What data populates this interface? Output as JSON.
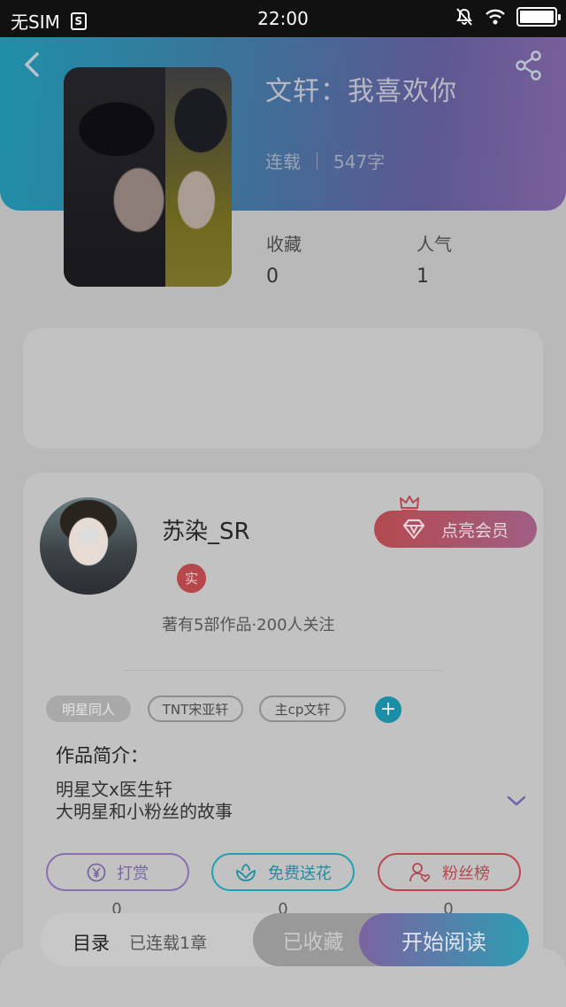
{
  "status_bar": {
    "carrier": "无SIM",
    "sim_icon_glyph": "S",
    "time": "22:00",
    "battery_level": 1.0,
    "icons": [
      "sim-card-icon",
      "bell-muted-icon",
      "wifi-icon",
      "battery-icon"
    ]
  },
  "header": {
    "back_icon": "chevron-left-icon",
    "share_icon": "share-icon",
    "gradient_colors": [
      "#1f8fa8",
      "#5c5891",
      "#7a5f9c"
    ]
  },
  "book": {
    "title": "文轩：我喜欢你",
    "status": "连载",
    "word_count": "547字"
  },
  "stats": [
    {
      "label": "收藏",
      "value": "0"
    },
    {
      "label": "人气",
      "value": "1"
    }
  ],
  "author": {
    "name": "苏染_SR",
    "verified_badge": "实",
    "meta": "著有5部作品·200人关注",
    "vip_button": "点亮会员"
  },
  "tags": [
    {
      "label": "明星同人"
    },
    {
      "label": "TNT宋亚轩"
    },
    {
      "label": "主cp文轩"
    }
  ],
  "intro": {
    "title": "作品简介：",
    "lines": [
      "明星文x医生轩",
      "大明星和小粉丝的故事"
    ]
  },
  "actions": [
    {
      "label": "打赏",
      "icon": "yen-coin-icon",
      "count": "0"
    },
    {
      "label": "免费送花",
      "icon": "flower-icon",
      "count": "0"
    },
    {
      "label": "粉丝榜",
      "icon": "user-heart-icon",
      "count": "0"
    }
  ],
  "bottom_bar": {
    "toc_label": "目录",
    "serial_label": "已连载1章",
    "favorited_label": "已收藏",
    "read_label": "开始阅读"
  },
  "colors": {
    "accent_purple": "#7b63a0",
    "accent_teal": "#2f9cb3",
    "accent_red": "#b8484d"
  }
}
